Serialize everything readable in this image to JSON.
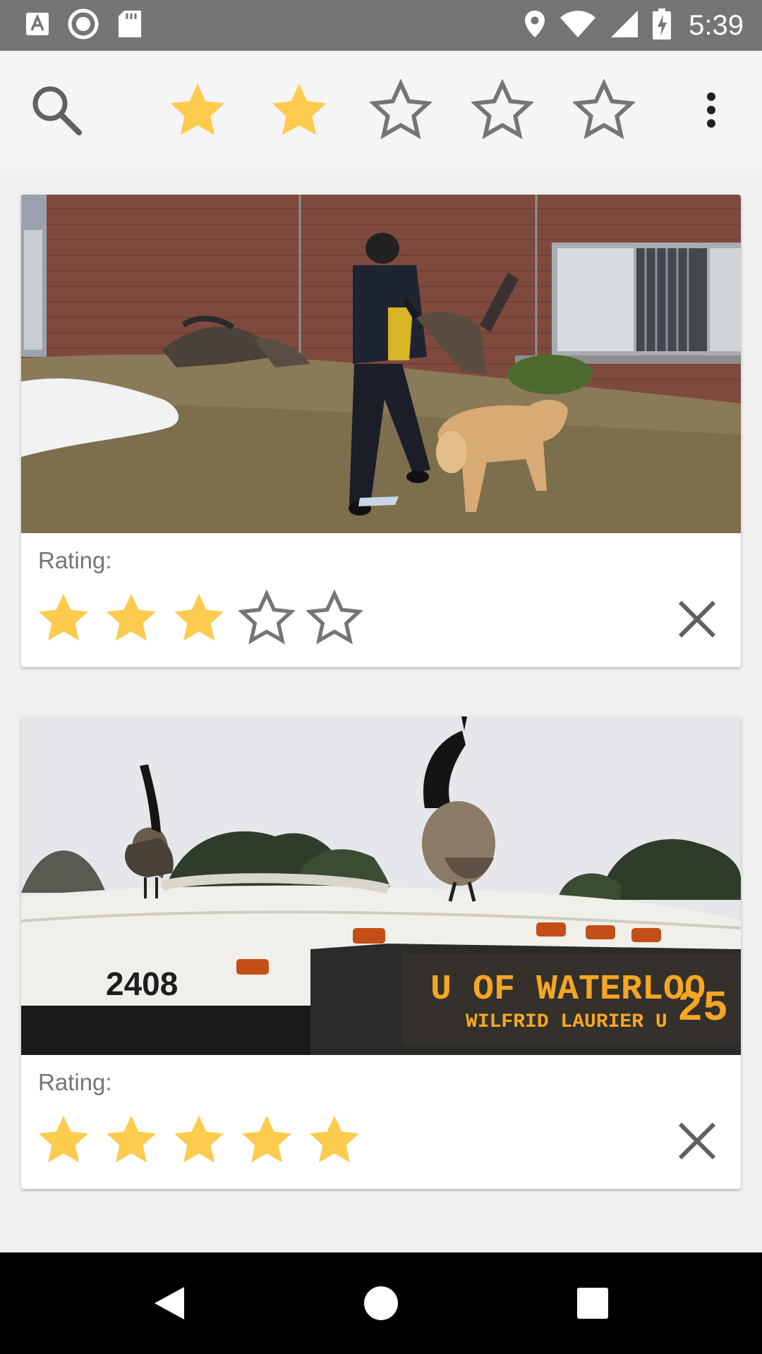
{
  "status_bar": {
    "time": "5:39",
    "icons": [
      "text-a-icon",
      "circle-record-icon",
      "sd-card-icon",
      "location-icon",
      "wifi-icon",
      "signal-icon",
      "battery-charging-icon"
    ],
    "background": "#757575"
  },
  "toolbar": {
    "search_icon": "search-icon",
    "filter_rating": 2,
    "filter_max": 5,
    "menu_icon": "more-vert-icon",
    "star_color": "#FDCB4E",
    "star_empty_color": "#757575"
  },
  "cards": [
    {
      "image_subject": "geese-dog-jogger",
      "rating_label": "Rating:",
      "rating": 3,
      "max": 5
    },
    {
      "image_subject": "geese-on-bus",
      "rating_label": "Rating:",
      "rating": 5,
      "max": 5,
      "bus_number": "2408",
      "bus_sign_line1": "U OF WATERLOO",
      "bus_sign_line2": "WILFRID LAURIER U",
      "bus_route": "25"
    }
  ],
  "nav_bar": {
    "back_icon": "back-icon",
    "home_icon": "home-icon",
    "recents_icon": "recents-icon"
  }
}
